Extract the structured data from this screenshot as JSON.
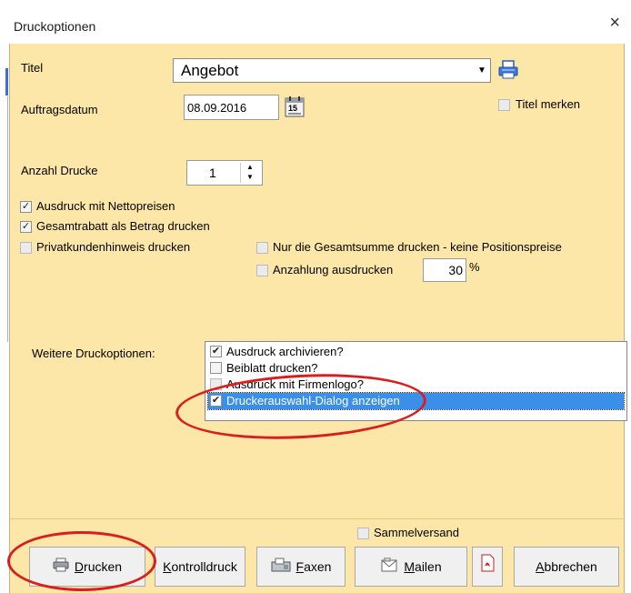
{
  "window": {
    "title": "Druckoptionen",
    "close_glyph": "×"
  },
  "form": {
    "title_label": "Titel",
    "title_value": "Angebot",
    "date_label": "Auftragsdatum",
    "date_value": "08.09.2016",
    "calendar_day": "15",
    "remember_title_label": "Titel merken",
    "count_label": "Anzahl Drucke",
    "count_value": "1"
  },
  "options": {
    "netto_label": "Ausdruck mit Nettopreisen",
    "rabatt_label": "Gesamtrabatt als Betrag drucken",
    "privat_label": "Privatkundenhinweis drucken",
    "gesamtsumme_label": "Nur die Gesamtsumme drucken - keine Positionspreise",
    "anzahlung_label": "Anzahlung ausdrucken",
    "anzahlung_value": "30",
    "percent": "%"
  },
  "more": {
    "label": "Weitere Druckoptionen:",
    "items": [
      {
        "label": "Ausdruck archivieren?",
        "checked": true
      },
      {
        "label": "Beiblatt drucken?",
        "checked": false
      },
      {
        "label": "Ausdruck mit Firmenlogo?",
        "checked": false
      },
      {
        "label": "Druckerauswahl-Dialog anzeigen",
        "checked": true
      }
    ]
  },
  "bottom": {
    "sammelversand_label": "Sammelversand",
    "drucken_first": "D",
    "drucken_rest": "rucken",
    "kontroll_first": "K",
    "kontroll_rest": "ontrolldruck",
    "faxen_first": "F",
    "faxen_rest": "axen",
    "mailen_first": "M",
    "mailen_rest": "ailen",
    "abbrechen_first": "A",
    "abbrechen_rest": "bbrechen"
  },
  "colors": {
    "panel": "#fde7a8",
    "selection": "#3a8fe8",
    "annotation": "#d81e1e"
  }
}
